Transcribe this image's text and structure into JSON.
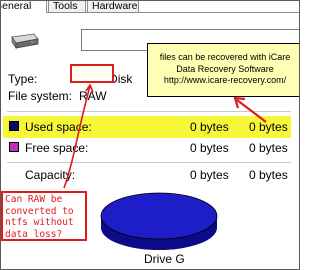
{
  "tabs": [
    "General",
    "Tools",
    "Hardware"
  ],
  "tooltip": {
    "lines": [
      "files can be recovered with iCare",
      "Data Recovery Software",
      "http://www.icare-recovery.com/"
    ]
  },
  "props": {
    "type_label": "Type:",
    "type_value": "Local Disk",
    "fs_label": "File system:",
    "fs_value": "RAW",
    "used_label": "Used space:",
    "used_bytes": "0 bytes",
    "used_size": "0 bytes",
    "free_label": "Free space:",
    "free_bytes": "0 bytes",
    "free_size": "0 bytes",
    "capacity_label": "Capacity:",
    "capacity_bytes": "0 bytes",
    "capacity_size": "0 bytes"
  },
  "colors": {
    "used": "#0a0a6e",
    "free": "#c030c0",
    "pie": "#1e1ec8",
    "annotation": "#e01b1b",
    "highlight": "#f7f73a",
    "tooltip_bg": "#ffffb4"
  },
  "question": {
    "lines": [
      "Can RAW be",
      "converted to",
      "ntfs without",
      "data loss?"
    ]
  },
  "drive_label": "Drive G"
}
